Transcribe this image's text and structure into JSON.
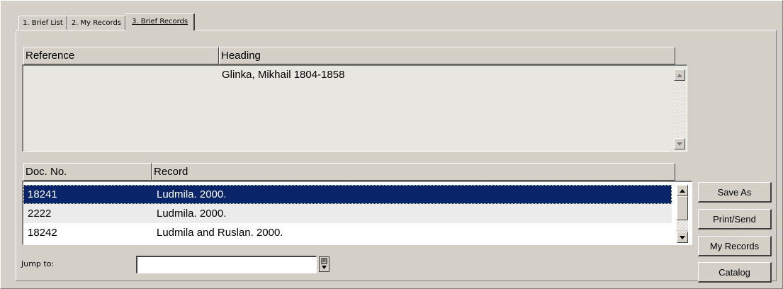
{
  "tabs": [
    {
      "label": "1. Brief List"
    },
    {
      "label": "2. My Records"
    },
    {
      "label": "3. Brief Records"
    }
  ],
  "heading_table": {
    "columns": [
      "Reference",
      "Heading"
    ],
    "rows": [
      {
        "reference": "",
        "heading": "Glinka, Mikhail 1804-1858"
      }
    ]
  },
  "records_table": {
    "columns": [
      "Doc. No.",
      "Record"
    ],
    "rows": [
      {
        "doc_no": "18241",
        "record": "Ludmila. 2000."
      },
      {
        "doc_no": "2222",
        "record": "Ludmila. 2000."
      },
      {
        "doc_no": "18242",
        "record": "Ludmila and Ruslan. 2000."
      }
    ],
    "selected_index": 0
  },
  "jump": {
    "label": "Jump to:",
    "value": ""
  },
  "buttons": {
    "save_as": "Save As",
    "print_send": "Print/Send",
    "my_records": "My Records",
    "catalog": "Catalog"
  },
  "colors": {
    "selection": "#0a246a",
    "window": "#d4d0c8",
    "row_alt": "#ebebeb"
  }
}
